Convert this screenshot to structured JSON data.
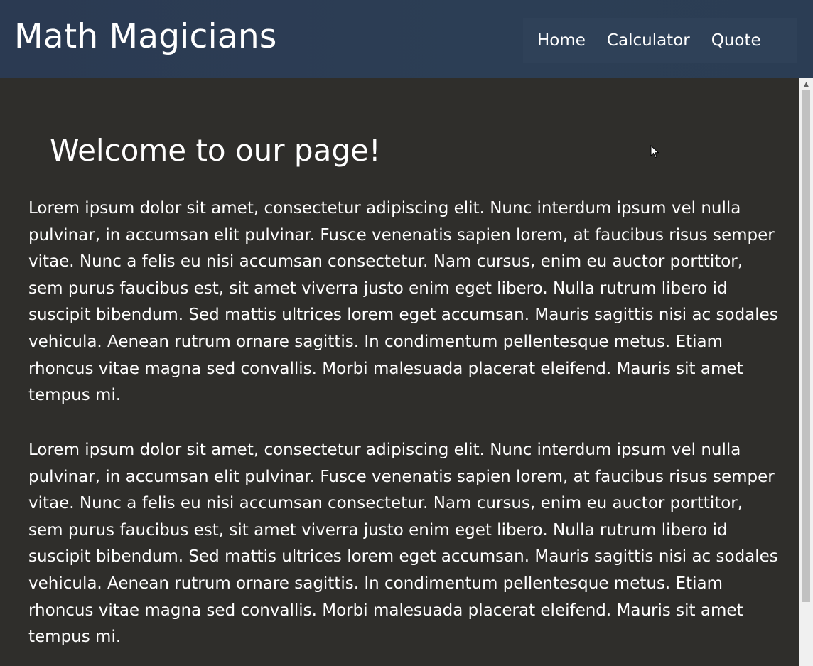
{
  "header": {
    "logo": "Math Magicians",
    "nav": [
      {
        "label": "Home"
      },
      {
        "label": "Calculator"
      },
      {
        "label": "Quote"
      }
    ]
  },
  "main": {
    "heading": "Welcome to our page!",
    "paragraphs": [
      "Lorem ipsum dolor sit amet, consectetur adipiscing elit. Nunc interdum ipsum vel nulla pulvinar, in accumsan elit pulvinar. Fusce venenatis sapien lorem, at faucibus risus semper vitae. Nunc a felis eu nisi accumsan consectetur. Nam cursus, enim eu auctor porttitor, sem purus faucibus est, sit amet viverra justo enim eget libero. Nulla rutrum libero id suscipit bibendum. Sed mattis ultrices lorem eget accumsan. Mauris sagittis nisi ac sodales vehicula. Aenean rutrum ornare sagittis. In condimentum pellentesque metus. Etiam rhoncus vitae magna sed convallis. Morbi malesuada placerat eleifend. Mauris sit amet tempus mi.",
      "Lorem ipsum dolor sit amet, consectetur adipiscing elit. Nunc interdum ipsum vel nulla pulvinar, in accumsan elit pulvinar. Fusce venenatis sapien lorem, at faucibus risus semper vitae. Nunc a felis eu nisi accumsan consectetur. Nam cursus, enim eu auctor porttitor, sem purus faucibus est, sit amet viverra justo enim eget libero. Nulla rutrum libero id suscipit bibendum. Sed mattis ultrices lorem eget accumsan. Mauris sagittis nisi ac sodales vehicula. Aenean rutrum ornare sagittis. In condimentum pellentesque metus. Etiam rhoncus vitae magna sed convallis. Morbi malesuada placerat eleifend. Mauris sit amet tempus mi."
    ]
  },
  "icons": {
    "scroll_up": "scroll-up-arrow-icon",
    "cursor": "mouse-cursor-icon"
  },
  "colors": {
    "header_bg": "#2c3e55",
    "nav_bg": "#2f4158",
    "page_bg": "#2f2e2b",
    "text": "#ffffff"
  }
}
